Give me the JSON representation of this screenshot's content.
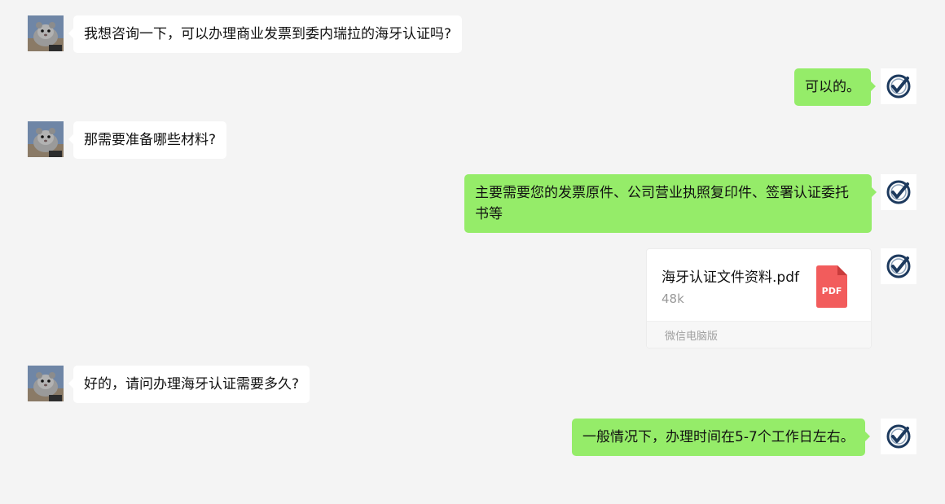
{
  "conversation": {
    "messages": [
      {
        "sender": "other",
        "text": "我想咨询一下，可以办理商业发票到委内瑞拉的海牙认证吗?"
      },
      {
        "sender": "me",
        "text": "可以的。"
      },
      {
        "sender": "other",
        "text": "那需要准备哪些材料?"
      },
      {
        "sender": "me",
        "text": "主要需要您的发票原件、公司营业执照复印件、签署认证委托书等"
      },
      {
        "sender": "me",
        "type": "file",
        "file_name": "海牙认证文件资料.pdf",
        "file_size": "48k",
        "file_icon_label": "PDF",
        "source": "微信电脑版"
      },
      {
        "sender": "other",
        "text": "好的，请问办理海牙认证需要多久?"
      },
      {
        "sender": "me",
        "text": "一般情况下，办理时间在5-7个工作日左右。"
      }
    ]
  },
  "avatars": {
    "other": "hamster-photo",
    "me": "checkmark-logo-icon"
  },
  "colors": {
    "background": "#f4f4f4",
    "my_bubble": "#95ec69",
    "other_bubble": "#ffffff",
    "pdf_icon": "#f25c5c",
    "logo_ring": "#1d3a5e"
  }
}
